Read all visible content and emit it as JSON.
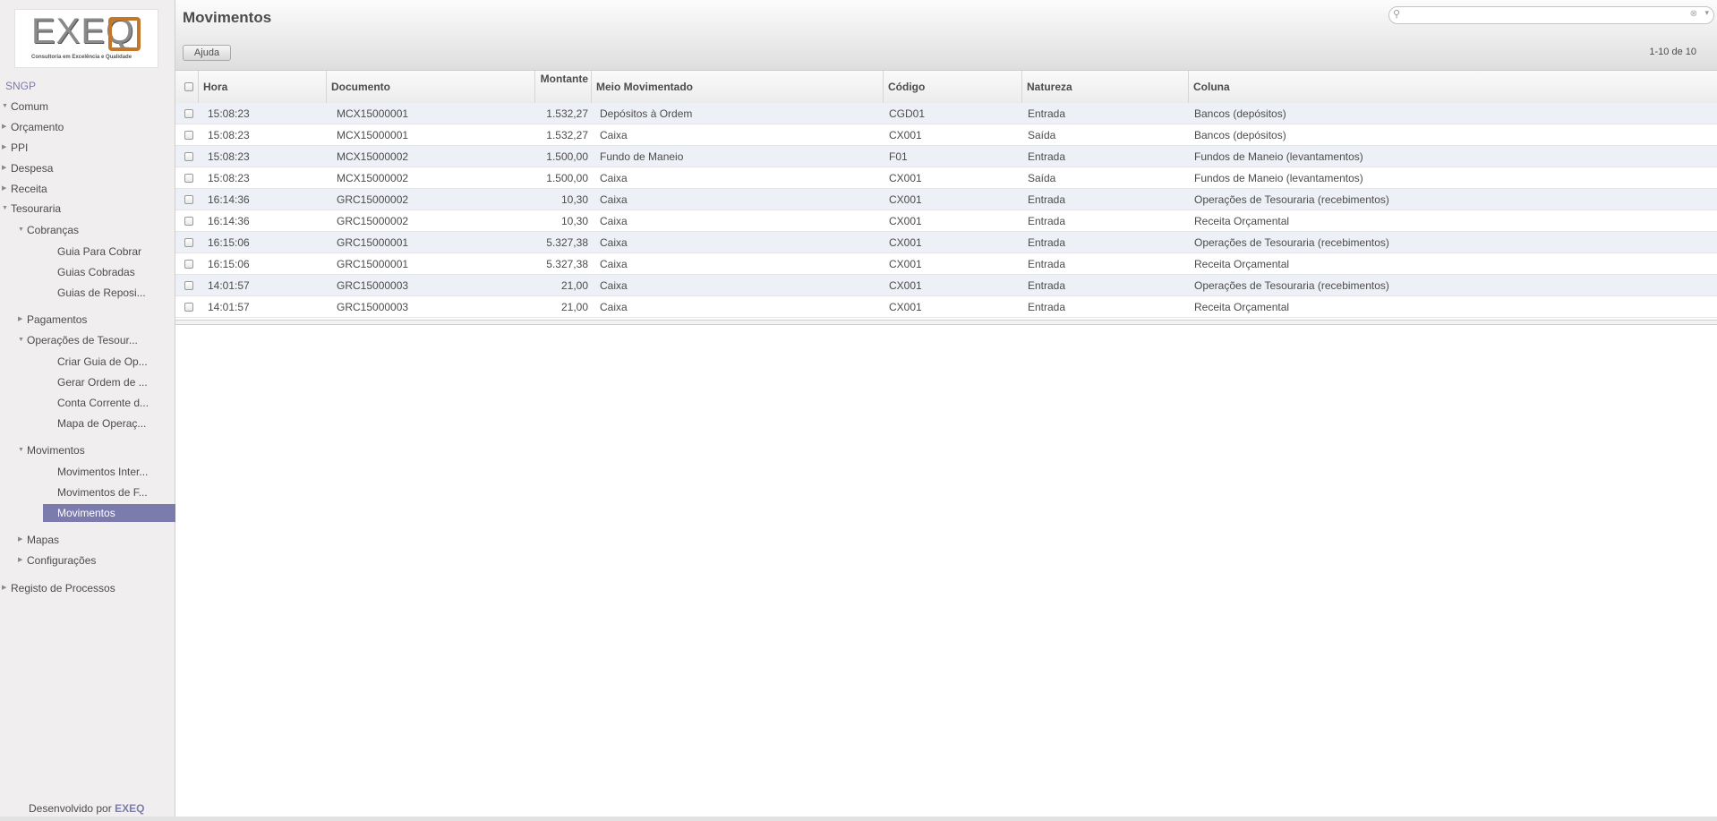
{
  "logo": {
    "text": "EXEQ",
    "tagline": "Consultoria em Excelência e Qualidade"
  },
  "sidebar": {
    "root_label": "SNGP",
    "items": [
      {
        "label": "Comum"
      },
      {
        "label": "Orçamento"
      },
      {
        "label": "PPI"
      },
      {
        "label": "Despesa"
      },
      {
        "label": "Receita"
      },
      {
        "label": "Tesouraria"
      },
      {
        "label": "Cobranças"
      },
      {
        "label": "Guia Para Cobrar"
      },
      {
        "label": "Guias Cobradas"
      },
      {
        "label": "Guias de Reposi..."
      },
      {
        "label": "Pagamentos"
      },
      {
        "label": "Operações de Tesour..."
      },
      {
        "label": "Criar Guia de Op..."
      },
      {
        "label": "Gerar Ordem de ..."
      },
      {
        "label": "Conta Corrente d..."
      },
      {
        "label": "Mapa de Operaç..."
      },
      {
        "label": "Movimentos"
      },
      {
        "label": "Movimentos Inter..."
      },
      {
        "label": "Movimentos de F..."
      },
      {
        "label": "Movimentos"
      },
      {
        "label": "Mapas"
      },
      {
        "label": "Configurações"
      },
      {
        "label": "Registo de Processos"
      }
    ],
    "footer_prefix": "Desenvolvido por",
    "footer_brand": "EXEQ"
  },
  "header": {
    "title": "Movimentos",
    "search_placeholder": "",
    "help_label": "Ajuda",
    "pager": "1-10 de 10"
  },
  "table": {
    "columns": [
      "Hora",
      "Documento",
      "Montante",
      "Meio Movimentado",
      "Código",
      "Natureza",
      "Coluna"
    ],
    "rows": [
      [
        "15:08:23",
        "MCX15000001",
        "1.532,27",
        "Depósitos à Ordem",
        "CGD01",
        "Entrada",
        "Bancos (depósitos)"
      ],
      [
        "15:08:23",
        "MCX15000001",
        "1.532,27",
        "Caixa",
        "CX001",
        "Saída",
        "Bancos (depósitos)"
      ],
      [
        "15:08:23",
        "MCX15000002",
        "1.500,00",
        "Fundo de Maneio",
        "F01",
        "Entrada",
        "Fundos de Maneio (levantamentos)"
      ],
      [
        "15:08:23",
        "MCX15000002",
        "1.500,00",
        "Caixa",
        "CX001",
        "Saída",
        "Fundos de Maneio (levantamentos)"
      ],
      [
        "16:14:36",
        "GRC15000002",
        "10,30",
        "Caixa",
        "CX001",
        "Entrada",
        "Operações de Tesouraria (recebimentos)"
      ],
      [
        "16:14:36",
        "GRC15000002",
        "10,30",
        "Caixa",
        "CX001",
        "Entrada",
        "Receita Orçamental"
      ],
      [
        "16:15:06",
        "GRC15000001",
        "5.327,38",
        "Caixa",
        "CX001",
        "Entrada",
        "Operações de Tesouraria (recebimentos)"
      ],
      [
        "16:15:06",
        "GRC15000001",
        "5.327,38",
        "Caixa",
        "CX001",
        "Entrada",
        "Receita Orçamental"
      ],
      [
        "14:01:57",
        "GRC15000003",
        "21,00",
        "Caixa",
        "CX001",
        "Entrada",
        "Operações de Tesouraria (recebimentos)"
      ],
      [
        "14:01:57",
        "GRC15000003",
        "21,00",
        "Caixa",
        "CX001",
        "Entrada",
        "Receita Orçamental"
      ]
    ]
  },
  "colors": {
    "accent": "#7c7bad",
    "row_alt": "#eef0f8",
    "logo_orange": "#c4772a"
  }
}
